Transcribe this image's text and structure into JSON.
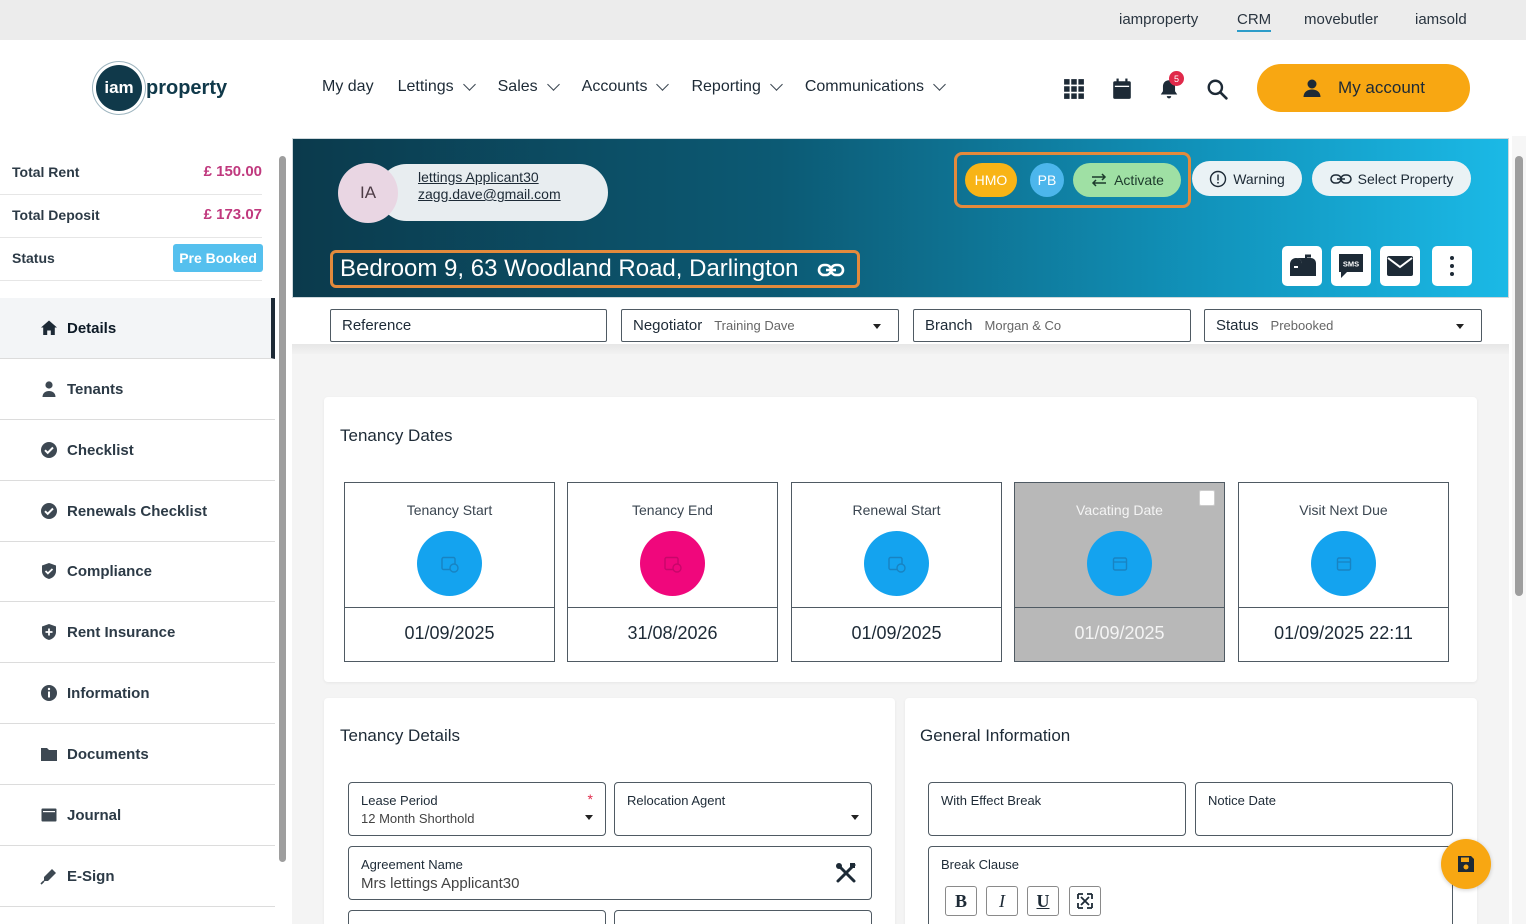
{
  "top_links": [
    "iamproperty",
    "CRM",
    "movebutler",
    "iamsold"
  ],
  "logo": {
    "mark": "iam",
    "text": "property"
  },
  "nav": {
    "items": [
      "My day",
      "Lettings",
      "Sales",
      "Accounts",
      "Reporting",
      "Communications"
    ],
    "notification_count": "5",
    "my_account": "My account"
  },
  "sidebar": {
    "summary": [
      {
        "label": "Total Rent",
        "value": "£ 150.00"
      },
      {
        "label": "Total Deposit",
        "value": "£ 173.07"
      }
    ],
    "status_label": "Status",
    "status_value": "Pre Booked",
    "items": [
      {
        "label": "Details",
        "icon": "home-icon"
      },
      {
        "label": "Tenants",
        "icon": "user-icon"
      },
      {
        "label": "Checklist",
        "icon": "check-circle-icon"
      },
      {
        "label": "Renewals Checklist",
        "icon": "check-circle-icon"
      },
      {
        "label": "Compliance",
        "icon": "shield-check-icon"
      },
      {
        "label": "Rent Insurance",
        "icon": "shield-plus-icon"
      },
      {
        "label": "Information",
        "icon": "info-icon"
      },
      {
        "label": "Documents",
        "icon": "folder-icon"
      },
      {
        "label": "Journal",
        "icon": "journal-icon"
      },
      {
        "label": "E-Sign",
        "icon": "pen-icon"
      }
    ]
  },
  "banner": {
    "initials": "IA",
    "applicant_name": "lettings Applicant30",
    "applicant_email": "zagg.dave@gmail.com",
    "address": "Bedroom 9, 63 Woodland Road, Darlington",
    "tags": {
      "hmo": "HMO",
      "pb": "PB",
      "activate": "Activate"
    },
    "warning": "Warning",
    "select_property": "Select Property",
    "sms": "SMS"
  },
  "fields": {
    "reference": {
      "label": "Reference",
      "value": ""
    },
    "negotiator": {
      "label": "Negotiator",
      "value": "Training Dave"
    },
    "branch": {
      "label": "Branch",
      "value": "Morgan & Co"
    },
    "status": {
      "label": "Status",
      "value": "Prebooked"
    }
  },
  "tenancy_dates": {
    "title": "Tenancy Dates",
    "items": [
      {
        "label": "Tenancy Start",
        "value": "01/09/2025",
        "color": "#14a3ef"
      },
      {
        "label": "Tenancy End",
        "value": "31/08/2026",
        "color": "#f0077c"
      },
      {
        "label": "Renewal Start",
        "value": "01/09/2025",
        "color": "#14a3ef"
      },
      {
        "label": "Vacating Date",
        "value": "01/09/2025",
        "color": "#14a3ef"
      },
      {
        "label": "Visit Next Due",
        "value": "01/09/2025 22:11",
        "color": "#14a3ef"
      }
    ]
  },
  "tenancy_details": {
    "title": "Tenancy Details",
    "lease_period": {
      "label": "Lease Period",
      "value": "12 Month Shorthold",
      "required": "*"
    },
    "relocation_agent": {
      "label": "Relocation Agent",
      "value": ""
    },
    "agreement_name": {
      "label": "Agreement Name",
      "value": "Mrs lettings Applicant30"
    }
  },
  "general_information": {
    "title": "General Information",
    "with_effect_break": {
      "label": "With Effect Break"
    },
    "notice_date": {
      "label": "Notice Date"
    },
    "break_clause": {
      "label": "Break Clause"
    },
    "toolbar": [
      "B",
      "I",
      "U"
    ]
  },
  "colors": {
    "accent": "#f8a712",
    "money": "#c0397e",
    "badge": "#55c0ee"
  }
}
